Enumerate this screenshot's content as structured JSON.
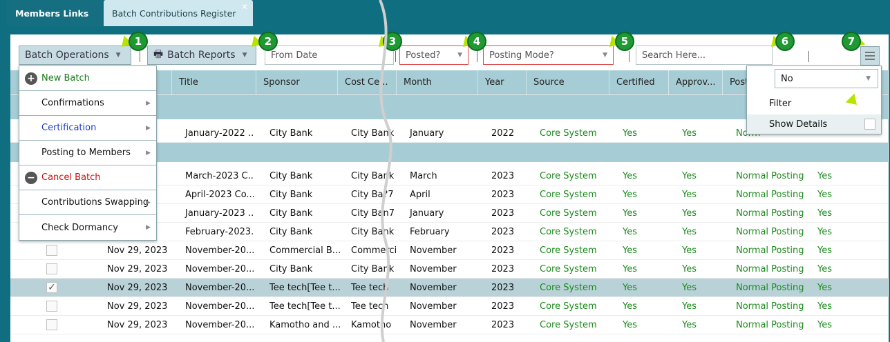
{
  "tabs": [
    {
      "label": "Members Links"
    },
    {
      "label": "Batch Contributions Register"
    }
  ],
  "toolbar": {
    "batch_operations": "Batch Operations",
    "batch_reports": "Batch Reports",
    "from_date_placeholder": "From Date",
    "posted_placeholder": "Posted?",
    "posting_mode_placeholder": "Posting Mode?",
    "search_placeholder": "Search Here..."
  },
  "badges": [
    "1",
    "2",
    "3",
    "4",
    "5",
    "6",
    "7"
  ],
  "columns": [
    "Title",
    "Sponsor",
    "Cost Ce...",
    "Month",
    "Year",
    "Source",
    "Certified",
    "Approv...",
    "Post"
  ],
  "batch_menu": [
    {
      "label": "New Batch",
      "icon": "plus-circle-icon",
      "color": "#1a7a1a"
    },
    {
      "label": "Confirmations",
      "submenu": true
    },
    {
      "label": "Certification",
      "submenu": true,
      "color": "#1f3fbf"
    },
    {
      "label": "Posting to Members",
      "submenu": true
    },
    {
      "label": "Cancel Batch",
      "icon": "minus-circle-icon",
      "color": "#d01010"
    },
    {
      "label": "Contributions Swapping",
      "submenu": true
    },
    {
      "label": "Check Dormancy",
      "submenu": true
    }
  ],
  "column_menu": {
    "selected": "No",
    "items": [
      "Filter",
      "Show Details"
    ]
  },
  "rows": [
    {
      "date": "",
      "title": "January-2022 ...",
      "sponsor": "City Bank",
      "cost": "City Bank",
      "month": "January",
      "year": "2022",
      "source": "Core System",
      "certified": "Yes",
      "approved": "Yes",
      "posting": "Norm",
      "posted": ""
    },
    {
      "date": "",
      "title": "March-2023 C...",
      "sponsor": "City Bank",
      "cost": "City Bank",
      "month": "March",
      "year": "2023",
      "source": "Core System",
      "certified": "Yes",
      "approved": "Yes",
      "posting": "Normal Posting",
      "posted": "Yes"
    },
    {
      "date": "",
      "title": "April-2023 Co...",
      "sponsor": "City Bank",
      "cost": "City Ba?7",
      "month": "April",
      "year": "2023",
      "source": "Core System",
      "certified": "Yes",
      "approved": "Yes",
      "posting": "Normal Posting",
      "posted": "Yes"
    },
    {
      "date": "",
      "title": "January-2023 ...",
      "sponsor": "City Bank",
      "cost": "City Ban7",
      "month": "January",
      "year": "2023",
      "source": "Core System",
      "certified": "Yes",
      "approved": "Yes",
      "posting": "Normal Posting",
      "posted": "Yes"
    },
    {
      "date": "",
      "title": "February-2023...",
      "sponsor": "City Bank",
      "cost": "City Bank",
      "month": "February",
      "year": "2023",
      "source": "Core System",
      "certified": "Yes",
      "approved": "Yes",
      "posting": "Normal Posting",
      "posted": "Yes"
    },
    {
      "date": "Nov 29, 2023",
      "title": "November-20...",
      "sponsor": "Commercial B...",
      "cost": "Commercia",
      "month": "November",
      "year": "2023",
      "source": "Core System",
      "certified": "Yes",
      "approved": "Yes",
      "posting": "Normal Posting",
      "posted": "Yes"
    },
    {
      "date": "Nov 29, 2023",
      "title": "November-20...",
      "sponsor": "City Bank",
      "cost": "City Bank",
      "month": "November",
      "year": "2023",
      "source": "Core System",
      "certified": "Yes",
      "approved": "Yes",
      "posting": "Normal Posting",
      "posted": "Yes"
    },
    {
      "date": "Nov 29, 2023",
      "title": "November-20...",
      "sponsor": "Tee tech[Tee t...",
      "cost": "Tee tech",
      "month": "November",
      "year": "2023",
      "source": "Core System",
      "certified": "Yes",
      "approved": "Yes",
      "posting": "Normal Posting",
      "posted": "Yes"
    },
    {
      "date": "Nov 29, 2023",
      "title": "November-20...",
      "sponsor": "Tee tech[Tee t...",
      "cost": "Tee tech",
      "month": "November",
      "year": "2023",
      "source": "Core System",
      "certified": "Yes",
      "approved": "Yes",
      "posting": "Normal Posting",
      "posted": "Yes"
    },
    {
      "date": "Nov 29, 2023",
      "title": "November-20...",
      "sponsor": "Kamotho and ...",
      "cost": "Kamotho",
      "month": "November",
      "year": "2023",
      "source": "Core System",
      "certified": "Yes",
      "approved": "Yes",
      "posting": "Normal Posting",
      "posted": "Yes"
    }
  ],
  "selected_row": 7,
  "colors": {
    "accent": "#0f6e80",
    "header": "#a6cdd5",
    "green": "#1a8a1a",
    "badge": "#1f9a33",
    "arrow": "#b8e400"
  }
}
